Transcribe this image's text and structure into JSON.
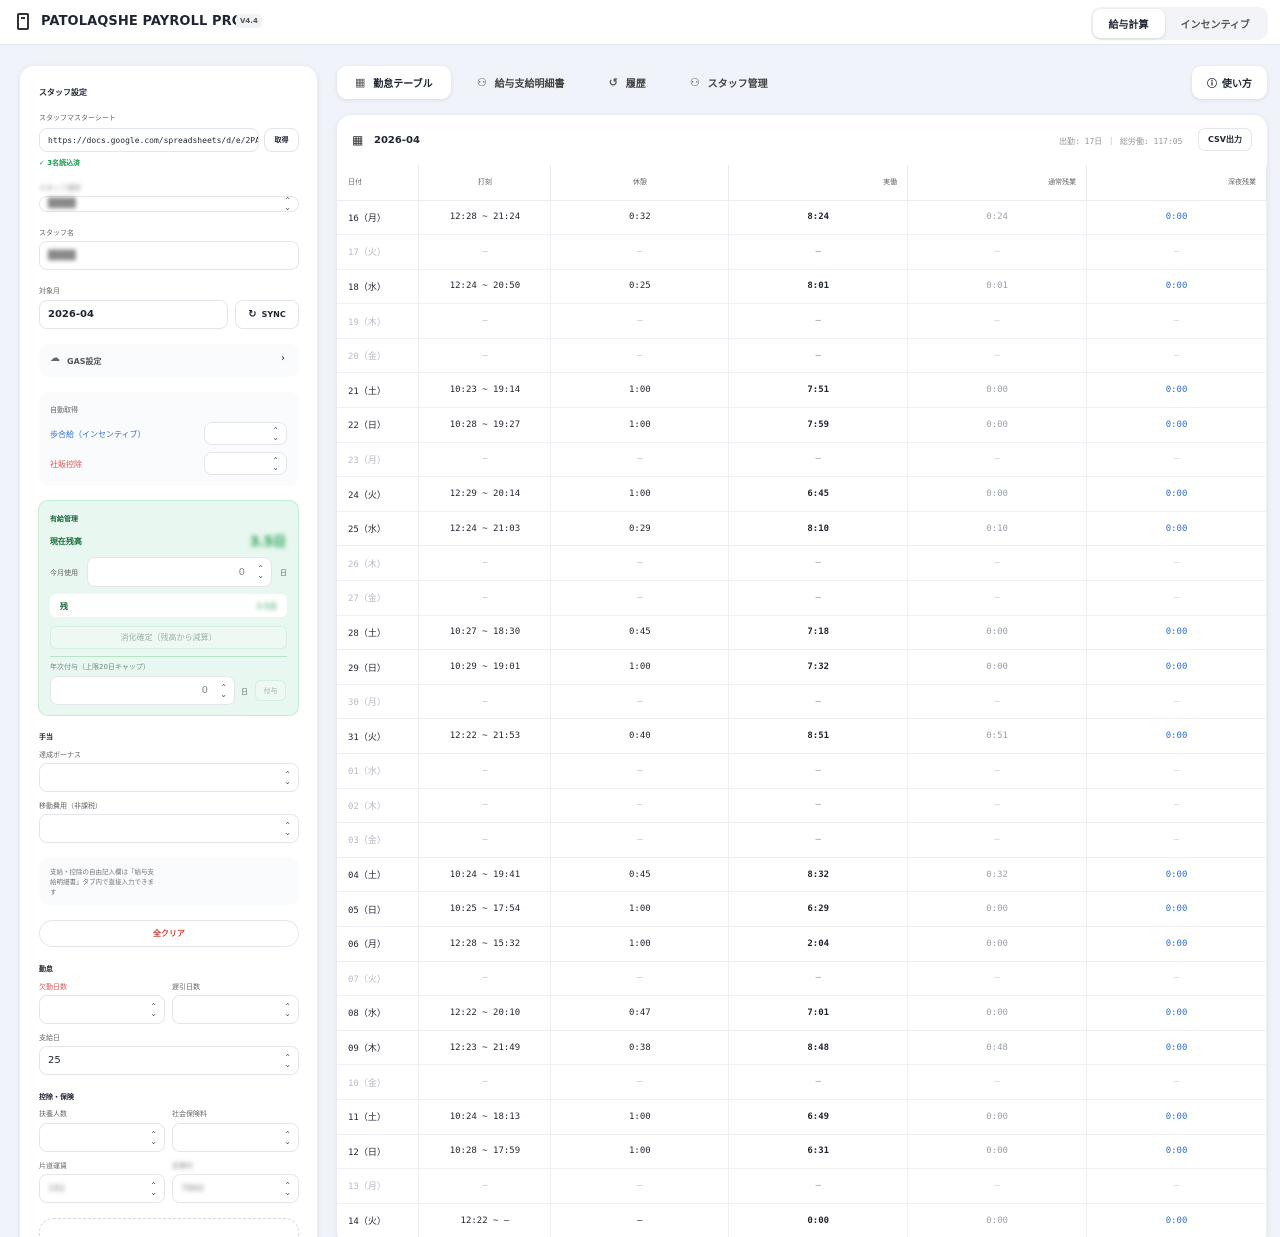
{
  "header": {
    "title": "PATOLAQSHE PAYROLL PRO",
    "version": "V4.4",
    "nav": [
      "給与計算",
      "インセンティブ"
    ]
  },
  "sidebar": {
    "section_title": "スタッフ設定",
    "master_sheet_label": "スタッフマスターシート",
    "master_sheet_url": "https://docs.google.com/spreadsheets/d/e/2PA",
    "fetch_label": "取得",
    "loaded_status": "✓ 3名読込済",
    "staff_select_label": "スタッフ選択",
    "staff_select_value": "████",
    "staff_name_label": "スタッフ名",
    "staff_name_value": "████",
    "month_label": "対象月",
    "month_value": "2026-04",
    "sync_label": "SYNC",
    "gas_label": "GAS設定",
    "auto_title": "自動取得",
    "incentive_label": "歩合給（インセンティブ）",
    "shaban_label": "社販控除",
    "leave": {
      "title": "有給管理",
      "balance_label": "現在残高",
      "balance_value": "3.5日",
      "this_month_label": "今月使用",
      "this_month_value": "0",
      "unit": "日",
      "remain_label": "残",
      "remain_value": "3.5日",
      "confirm_label": "消化確定（残高から減算）",
      "grant_label": "年次付与（上限20日キャップ）",
      "grant_value": "0",
      "grant_unit": "日",
      "grant_btn": "付与"
    },
    "allowance_title": "手当",
    "bonus_label": "達成ボーナス",
    "travel_label": "移動費用（非課税）",
    "note": "支給・控除の自由記入欄は「給与支給明細書」タブ内で直接入力できます",
    "clear_label": "全クリア",
    "attendance_title": "勤怠",
    "absent_label": "欠勤日数",
    "late_label": "遅引日数",
    "payday_label": "支給日",
    "payday_value": "25",
    "insurance_title": "控除・保険",
    "dependents_label": "扶養人数",
    "social_label": "社会保険料",
    "commute_label": "片道運賃",
    "commute_value": "182",
    "pass_label": "定期代",
    "pass_value": "7860"
  },
  "tabs": [
    "勤怠テーブル",
    "給与支給明細書",
    "履歴",
    "スタッフ管理"
  ],
  "help_label": "使い方",
  "table": {
    "month": "2026-04",
    "summary": "出勤: 17日 ｜ 総労働: 117:05",
    "csv_label": "CSV出力",
    "headers": [
      "日付",
      "打刻",
      "休憩",
      "実働",
      "通常残業",
      "深夜残業"
    ],
    "rows": [
      [
        "16（月）",
        "12:28 ~ 21:24",
        "0:32",
        "8:24",
        "0:24",
        "0:00"
      ],
      [
        "17（火）",
        "–",
        "–",
        "–",
        "–",
        "–"
      ],
      [
        "18（水）",
        "12:24 ~ 20:50",
        "0:25",
        "8:01",
        "0:01",
        "0:00"
      ],
      [
        "19（木）",
        "–",
        "–",
        "–",
        "–",
        "–"
      ],
      [
        "20（金）",
        "–",
        "–",
        "–",
        "–",
        "–"
      ],
      [
        "21（土）",
        "10:23 ~ 19:14",
        "1:00",
        "7:51",
        "0:00",
        "0:00"
      ],
      [
        "22（日）",
        "10:28 ~ 19:27",
        "1:00",
        "7:59",
        "0:00",
        "0:00"
      ],
      [
        "23（月）",
        "–",
        "–",
        "–",
        "–",
        "–"
      ],
      [
        "24（火）",
        "12:29 ~ 20:14",
        "1:00",
        "6:45",
        "0:00",
        "0:00"
      ],
      [
        "25（水）",
        "12:24 ~ 21:03",
        "0:29",
        "8:10",
        "0:10",
        "0:00"
      ],
      [
        "26（木）",
        "–",
        "–",
        "–",
        "–",
        "–"
      ],
      [
        "27（金）",
        "–",
        "–",
        "–",
        "–",
        "–"
      ],
      [
        "28（土）",
        "10:27 ~ 18:30",
        "0:45",
        "7:18",
        "0:00",
        "0:00"
      ],
      [
        "29（日）",
        "10:29 ~ 19:01",
        "1:00",
        "7:32",
        "0:00",
        "0:00"
      ],
      [
        "30（月）",
        "–",
        "–",
        "–",
        "–",
        "–"
      ],
      [
        "31（火）",
        "12:22 ~ 21:53",
        "0:40",
        "8:51",
        "0:51",
        "0:00"
      ],
      [
        "01（水）",
        "–",
        "–",
        "–",
        "–",
        "–"
      ],
      [
        "02（木）",
        "–",
        "–",
        "–",
        "–",
        "–"
      ],
      [
        "03（金）",
        "–",
        "–",
        "–",
        "–",
        "–"
      ],
      [
        "04（土）",
        "10:24 ~ 19:41",
        "0:45",
        "8:32",
        "0:32",
        "0:00"
      ],
      [
        "05（日）",
        "10:25 ~ 17:54",
        "1:00",
        "6:29",
        "0:00",
        "0:00"
      ],
      [
        "06（月）",
        "12:28 ~ 15:32",
        "1:00",
        "2:04",
        "0:00",
        "0:00"
      ],
      [
        "07（火）",
        "–",
        "–",
        "–",
        "–",
        "–"
      ],
      [
        "08（水）",
        "12:22 ~ 20:10",
        "0:47",
        "7:01",
        "0:00",
        "0:00"
      ],
      [
        "09（木）",
        "12:23 ~ 21:49",
        "0:38",
        "8:48",
        "0:48",
        "0:00"
      ],
      [
        "10（金）",
        "–",
        "–",
        "–",
        "–",
        "–"
      ],
      [
        "11（土）",
        "10:24 ~ 18:13",
        "1:00",
        "6:49",
        "0:00",
        "0:00"
      ],
      [
        "12（日）",
        "10:28 ~ 17:59",
        "1:00",
        "6:31",
        "0:00",
        "0:00"
      ],
      [
        "13（月）",
        "–",
        "–",
        "–",
        "–",
        "–"
      ],
      [
        "14（火）",
        "12:22 ~ –",
        "–",
        "0:00",
        "0:00",
        "0:00"
      ]
    ]
  }
}
